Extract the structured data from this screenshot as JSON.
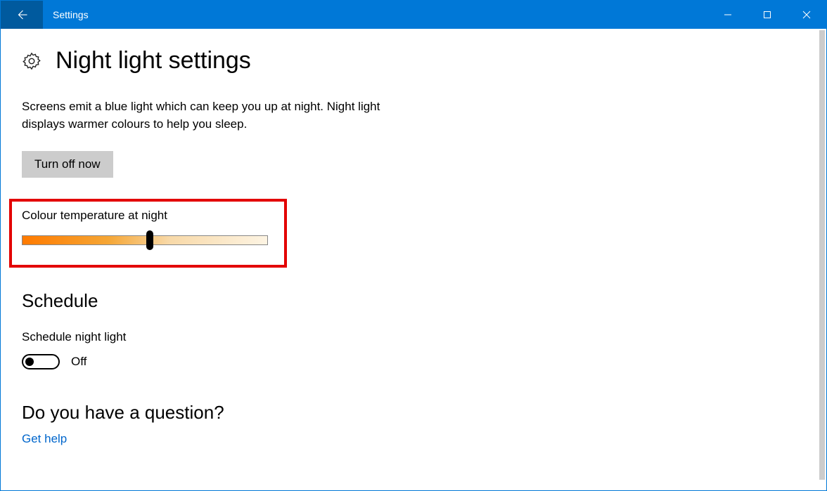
{
  "window": {
    "title": "Settings"
  },
  "page": {
    "title": "Night light settings",
    "description": "Screens emit a blue light which can keep you up at night. Night light displays warmer colours to help you sleep.",
    "turn_off_label": "Turn off now",
    "slider_label": "Colour temperature at night",
    "slider_value_pct": 52,
    "schedule_heading": "Schedule",
    "schedule_toggle_label": "Schedule night light",
    "schedule_toggle_state": "Off",
    "question_heading": "Do you have a question?",
    "get_help_label": "Get help"
  },
  "colors": {
    "accent": "#0078d7",
    "highlight": "#e30000",
    "link": "#0066cc"
  }
}
